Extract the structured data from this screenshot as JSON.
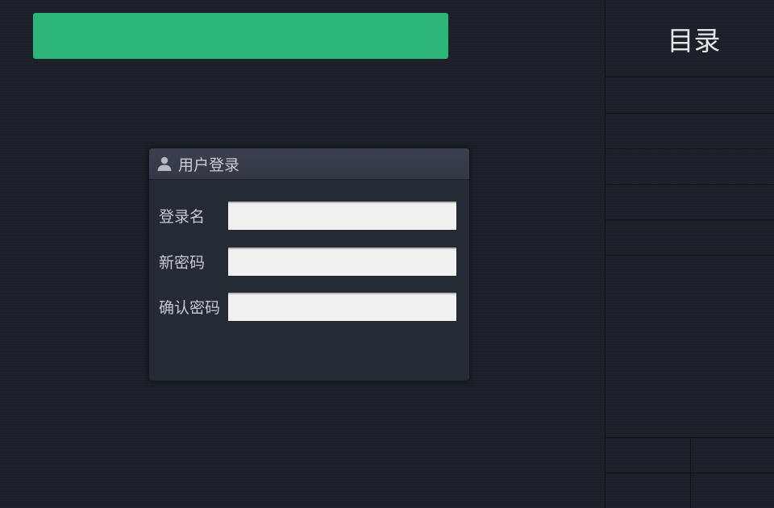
{
  "login_panel": {
    "title": "用户登录",
    "fields": [
      {
        "label": "登录名",
        "value": "",
        "placeholder": ""
      },
      {
        "label": "新密码",
        "value": "",
        "placeholder": ""
      },
      {
        "label": "确认密码",
        "value": "",
        "placeholder": ""
      }
    ],
    "icon": "user-icon"
  },
  "sidebar": {
    "title": "目录"
  },
  "colors": {
    "accent_bar": "#2db679",
    "background": "#1b2029",
    "panel": "#252b35",
    "panel_header": "#363c49"
  }
}
